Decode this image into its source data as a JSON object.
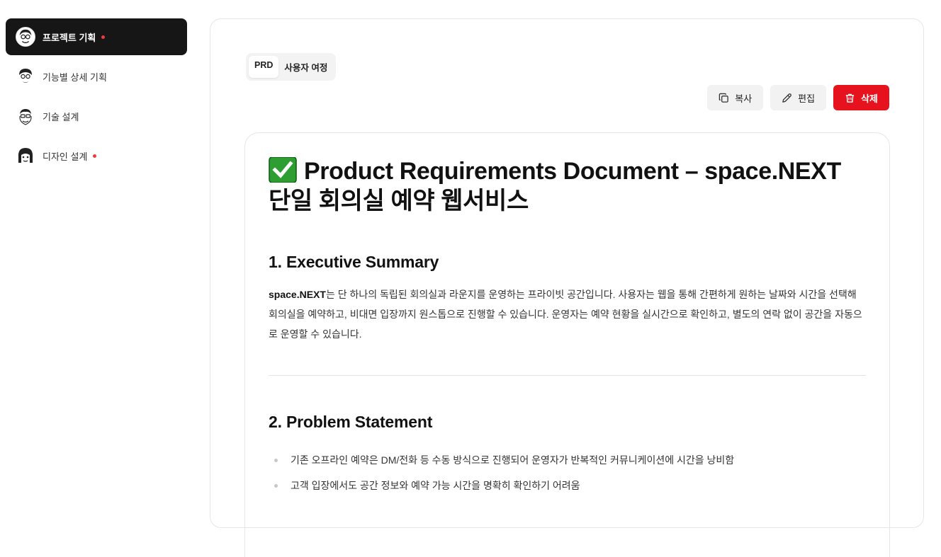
{
  "sidebar": {
    "items": [
      {
        "label": "프로젝트 기획",
        "active": true,
        "dot": true
      },
      {
        "label": "기능별 상세 기획",
        "active": false,
        "dot": false
      },
      {
        "label": "기술 설계",
        "active": false,
        "dot": false
      },
      {
        "label": "디자인 설계",
        "active": false,
        "dot": true
      }
    ]
  },
  "tabs": [
    {
      "label": "PRD",
      "active": true
    },
    {
      "label": "사용자 여정",
      "active": false
    }
  ],
  "actions": {
    "copy_label": "복사",
    "edit_label": "편집",
    "delete_label": "삭제"
  },
  "document": {
    "title": "Product Requirements Document – space.NEXT 단일 회의실 예약 웹서비스",
    "sections": [
      {
        "heading": "1. Executive Summary",
        "lead_bold": "space.NEXT",
        "body": "는 단 하나의 독립된 회의실과 라운지를 운영하는 프라이빗 공간입니다. 사용자는 웹을 통해 간편하게 원하는 날짜와 시간을 선택해 회의실을 예약하고, 비대면 입장까지 원스톱으로 진행할 수 있습니다. 운영자는 예약 현황을 실시간으로 확인하고, 별도의 연락 없이 공간을 자동으로 운영할 수 있습니다."
      },
      {
        "heading": "2. Problem Statement",
        "bullets": [
          "기존 오프라인 예약은 DM/전화 등 수동 방식으로 진행되어 운영자가 반복적인 커뮤니케이션에 시간을 낭비함",
          "고객 입장에서도 공간 정보와 예약 가능 시간을 명확히 확인하기 어려움"
        ]
      }
    ]
  },
  "colors": {
    "active_nav_bg": "#161616",
    "danger": "#e6121d",
    "dot": "#ef3b3b",
    "check_green": "#2e9e33"
  }
}
